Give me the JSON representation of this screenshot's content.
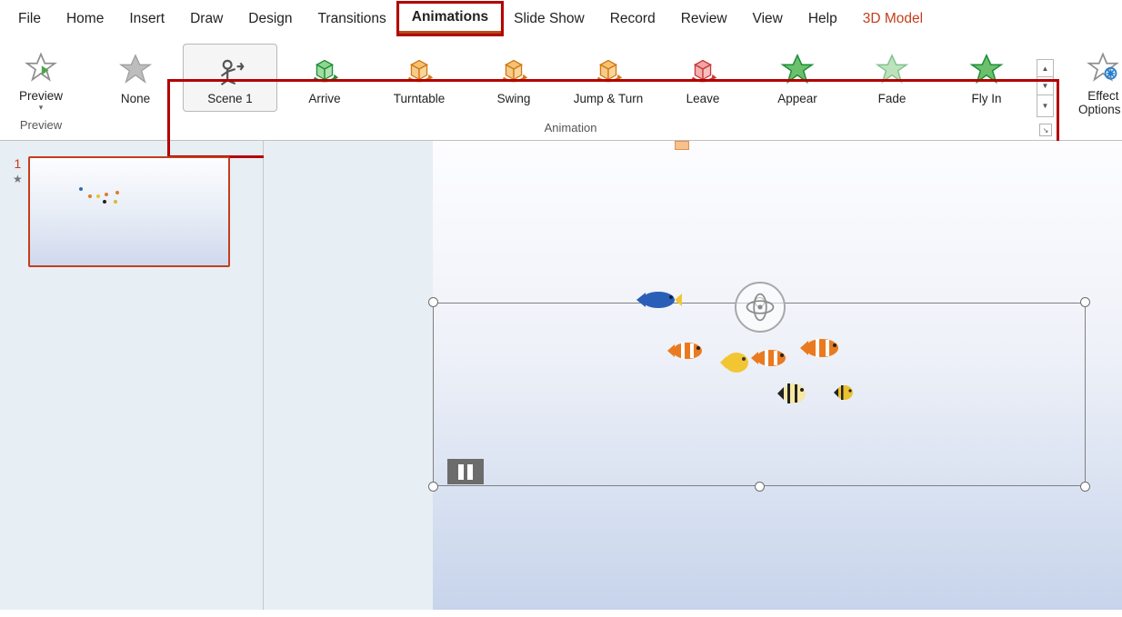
{
  "menu": {
    "tabs": [
      {
        "label": "File"
      },
      {
        "label": "Home"
      },
      {
        "label": "Insert"
      },
      {
        "label": "Draw"
      },
      {
        "label": "Design"
      },
      {
        "label": "Transitions"
      },
      {
        "label": "Animations",
        "active": true
      },
      {
        "label": "Slide Show"
      },
      {
        "label": "Record"
      },
      {
        "label": "Review"
      },
      {
        "label": "View"
      },
      {
        "label": "Help"
      },
      {
        "label": "3D Model",
        "context": true
      }
    ]
  },
  "ribbon": {
    "preview": {
      "label": "Preview",
      "group_label": "Preview"
    },
    "animation": {
      "group_label": "Animation",
      "items": [
        {
          "name": "none",
          "label": "None",
          "kind": "none"
        },
        {
          "name": "scene1",
          "label": "Scene 1",
          "kind": "scene",
          "selected": true
        },
        {
          "name": "arrive",
          "label": "Arrive",
          "kind": "cube-green"
        },
        {
          "name": "turntable",
          "label": "Turntable",
          "kind": "cube-orange"
        },
        {
          "name": "swing",
          "label": "Swing",
          "kind": "cube-orange"
        },
        {
          "name": "jump-turn",
          "label": "Jump & Turn",
          "kind": "cube-orange"
        },
        {
          "name": "leave",
          "label": "Leave",
          "kind": "cube-red"
        },
        {
          "name": "appear",
          "label": "Appear",
          "kind": "star-green"
        },
        {
          "name": "fade",
          "label": "Fade",
          "kind": "star-green-faded"
        },
        {
          "name": "fly-in",
          "label": "Fly In",
          "kind": "star-green"
        }
      ]
    },
    "effect_options": {
      "label_line1": "Effect",
      "label_line2": "Options"
    }
  },
  "thumb": {
    "slide_number": "1",
    "star": "★"
  }
}
